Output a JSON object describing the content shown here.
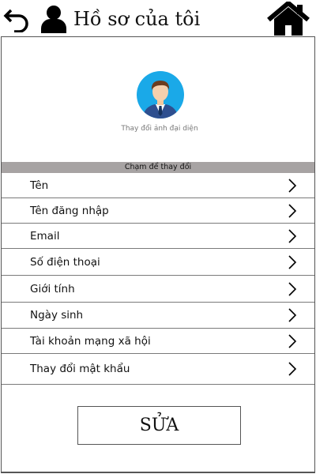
{
  "header": {
    "title": "Hồ sơ của tôi",
    "back_icon": "back-arrow-icon",
    "user_icon": "user-silhouette-icon",
    "home_icon": "home-icon"
  },
  "profile": {
    "avatar_icon": "businessman-avatar-icon",
    "change_avatar_label": "Thay đổi ảnh đại diện"
  },
  "tap_banner": "Chạm để thay đổi",
  "menu": {
    "chevron_icon": "chevron-right-icon",
    "items": [
      {
        "label": "Tên"
      },
      {
        "label": "Tên đăng nhập"
      },
      {
        "label": "Email"
      },
      {
        "label": "Số điện thoại"
      },
      {
        "label": "Giới tính"
      },
      {
        "label": "Ngày sinh"
      },
      {
        "label": "Tài khoản mạng xã hội"
      },
      {
        "label": "Thay đổi mật khẩu"
      }
    ]
  },
  "edit_button_label": "SỬA",
  "colors": {
    "banner": "#a7a3a3",
    "avatar_bg": "#1aa9e8",
    "border": "#7a7a7a"
  }
}
